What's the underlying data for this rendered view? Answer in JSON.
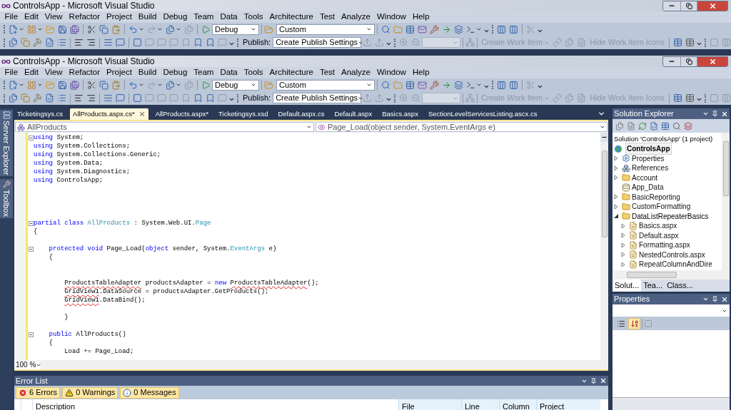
{
  "windows": [
    {
      "title": "ControlsApp - Microsoft Visual Studio",
      "menu": [
        "File",
        "Edit",
        "View",
        "Refactor",
        "Project",
        "Build",
        "Debug",
        "Team",
        "Data",
        "Tools",
        "Architecture",
        "Test",
        "Analyze",
        "Window",
        "Help"
      ],
      "toolbar": {
        "configuration": "Debug",
        "platform": "Custom",
        "publish_label": "Publish:",
        "publish_setting": "Create Publish Settings",
        "work_item": {
          "label": "Create Work Item",
          "disabled": true
        },
        "hide_icons": {
          "label": "Hide Work Item Icons",
          "disabled": true
        }
      }
    },
    {
      "title": "ControlsApp - Microsoft Visual Studio",
      "menu": [
        "File",
        "Edit",
        "View",
        "Refactor",
        "Project",
        "Build",
        "Debug",
        "Team",
        "Data",
        "Tools",
        "Architecture",
        "Test",
        "Analyze",
        "Window",
        "Help"
      ],
      "toolbar": {
        "configuration": "Debug",
        "platform": "Custom",
        "publish_label": "Publish:",
        "publish_setting": "Create Publish Settings",
        "work_item": {
          "label": "Create Work Item",
          "disabled": true
        },
        "hide_icons": {
          "label": "Hide Work Item Icons",
          "disabled": true
        }
      }
    }
  ],
  "left_dock": [
    "Server Explorer",
    "Toolbox"
  ],
  "editor": {
    "tabs": [
      {
        "label": "Ticketingsys.cs",
        "selected": false
      },
      {
        "label": "AllProducts.aspx.cs*",
        "selected": true
      },
      {
        "label": "AllProducts.aspx*",
        "selected": false
      },
      {
        "label": "Ticketingsys.xsd",
        "selected": false
      },
      {
        "label": "Default.aspx.cs",
        "selected": false
      },
      {
        "label": "Default.aspx",
        "selected": false
      },
      {
        "label": "Basics.aspx",
        "selected": false
      },
      {
        "label": "SectionLevelServicesListing.ascx.cs",
        "selected": false
      }
    ],
    "class_dropdown": "AllProducts",
    "member_dropdown": "Page_Load(object sender, System.EventArgs e)",
    "lines": [
      {
        "kind": "code",
        "fold": true,
        "tokens": [
          {
            "kind": "keyword",
            "text": "using"
          },
          {
            "kind": "plain",
            "text": " System;"
          }
        ]
      },
      {
        "kind": "code",
        "fold": false,
        "tokens": [
          {
            "kind": "keyword",
            "text": "using"
          },
          {
            "kind": "plain",
            "text": " System.Collections;"
          }
        ]
      },
      {
        "kind": "code",
        "fold": false,
        "tokens": [
          {
            "kind": "keyword",
            "text": "using"
          },
          {
            "kind": "plain",
            "text": " System.Collections.Generic;"
          }
        ]
      },
      {
        "kind": "code",
        "fold": false,
        "tokens": [
          {
            "kind": "keyword",
            "text": "using"
          },
          {
            "kind": "plain",
            "text": " System.Data;"
          }
        ]
      },
      {
        "kind": "code",
        "fold": false,
        "tokens": [
          {
            "kind": "keyword",
            "text": "using"
          },
          {
            "kind": "plain",
            "text": " System.Diagnostics;"
          }
        ]
      },
      {
        "kind": "code",
        "fold": false,
        "tokens": [
          {
            "kind": "keyword",
            "text": "using"
          },
          {
            "kind": "plain",
            "text": " ControlsApp;"
          }
        ]
      },
      {
        "kind": "blank",
        "fold": false
      },
      {
        "kind": "blank",
        "fold": false
      },
      {
        "kind": "blank",
        "fold": false
      },
      {
        "kind": "blank",
        "fold": false
      },
      {
        "kind": "code",
        "fold": true,
        "tokens": [
          {
            "kind": "keyword",
            "text": "partial class"
          },
          {
            "kind": "type",
            "text": " AllProducts"
          },
          {
            "kind": "plain",
            "text": " : System.Web.UI."
          },
          {
            "kind": "type",
            "text": "Page"
          }
        ]
      },
      {
        "kind": "code",
        "fold": false,
        "tokens": [
          {
            "kind": "plain",
            "text": "{"
          }
        ]
      },
      {
        "kind": "blank",
        "fold": false
      },
      {
        "kind": "code",
        "fold": true,
        "tokens": [
          {
            "kind": "keyword",
            "text": "    protected void"
          },
          {
            "kind": "plain",
            "text": " Page_Load("
          },
          {
            "kind": "keyword",
            "text": "object"
          },
          {
            "kind": "plain",
            "text": " sender, System."
          },
          {
            "kind": "type",
            "text": "EventArgs"
          },
          {
            "kind": "plain",
            "text": " e)"
          }
        ]
      },
      {
        "kind": "code",
        "fold": false,
        "tokens": [
          {
            "kind": "plain",
            "text": "    {"
          }
        ]
      },
      {
        "kind": "blank",
        "fold": false
      },
      {
        "kind": "blank",
        "fold": false
      },
      {
        "kind": "code",
        "fold": false,
        "tokens": [
          {
            "kind": "error",
            "text": "        ProductsTableAdapter"
          },
          {
            "kind": "plain",
            "text": " productsAdapter = "
          },
          {
            "kind": "keyword",
            "text": "new"
          },
          {
            "kind": "error",
            "text": " ProductsTableAdapter"
          },
          {
            "kind": "plain",
            "text": "();"
          }
        ]
      },
      {
        "kind": "code",
        "fold": false,
        "tokens": [
          {
            "kind": "error",
            "text": "        GridView1"
          },
          {
            "kind": "plain",
            "text": ".DataSource = productsAdapter.GetProducts();"
          }
        ]
      },
      {
        "kind": "code",
        "fold": false,
        "tokens": [
          {
            "kind": "error",
            "text": "        GridView1"
          },
          {
            "kind": "plain",
            "text": ".DataBind();"
          }
        ]
      },
      {
        "kind": "blank",
        "fold": false
      },
      {
        "kind": "code",
        "fold": false,
        "tokens": [
          {
            "kind": "plain",
            "text": "        }"
          }
        ]
      },
      {
        "kind": "blank",
        "fold": false
      },
      {
        "kind": "code",
        "fold": true,
        "tokens": [
          {
            "kind": "keyword",
            "text": "    public"
          },
          {
            "kind": "plain",
            "text": " AllProducts()"
          }
        ]
      },
      {
        "kind": "code",
        "fold": false,
        "tokens": [
          {
            "kind": "plain",
            "text": "    {"
          }
        ]
      },
      {
        "kind": "code",
        "fold": false,
        "tokens": [
          {
            "kind": "plain",
            "text": "        Load += Page_Load;"
          }
        ]
      }
    ],
    "zoom": "100 %"
  },
  "error_list": {
    "title": "Error List",
    "filters": [
      {
        "kind": "error",
        "label": "6 Errors",
        "selected": true
      },
      {
        "kind": "warning",
        "label": "0 Warnings",
        "selected": true
      },
      {
        "kind": "message",
        "label": "0 Messages",
        "selected": true
      }
    ],
    "columns": [
      "Description",
      "File",
      "Line",
      "Column",
      "Project"
    ]
  },
  "solution_explorer": {
    "title": "Solution Explorer",
    "solution": "Solution 'ControlsApp' (1 project)",
    "project": {
      "label": "ControlsApp",
      "selected": true
    },
    "items": [
      {
        "kind": "properties",
        "label": "Properties",
        "expandable": true,
        "expanded": false
      },
      {
        "kind": "references",
        "label": "References",
        "expandable": true,
        "expanded": false
      },
      {
        "kind": "folder",
        "label": "Account",
        "expandable": true,
        "expanded": false
      },
      {
        "kind": "data_folder",
        "label": "App_Data",
        "expandable": false
      },
      {
        "kind": "folder",
        "label": "BasicReporting",
        "expandable": true,
        "expanded": false
      },
      {
        "kind": "folder",
        "label": "CustomFormatting",
        "expandable": true,
        "expanded": false
      },
      {
        "kind": "folder",
        "label": "DataListRepeaterBasics",
        "expandable": true,
        "expanded": true,
        "children": [
          {
            "kind": "page",
            "label": "Basics.aspx",
            "expandable": true,
            "expanded": false
          },
          {
            "kind": "page",
            "label": "Default.aspx",
            "expandable": true,
            "expanded": false
          },
          {
            "kind": "page",
            "label": "Formatting.aspx",
            "expandable": true,
            "expanded": false
          },
          {
            "kind": "page",
            "label": "NestedControls.aspx",
            "expandable": true,
            "expanded": false
          },
          {
            "kind": "page",
            "label": "RepeatColumnAndDire",
            "expandable": true,
            "expanded": false
          }
        ]
      }
    ],
    "tabs": [
      {
        "label": "Solut...",
        "selected": true
      },
      {
        "label": "Tea...",
        "selected": false
      },
      {
        "label": "Class...",
        "selected": false
      }
    ]
  },
  "properties": {
    "title": "Properties",
    "sort_buttons": [
      {
        "kind": "categorized",
        "selected": false
      },
      {
        "kind": "alphabetical",
        "selected": true
      }
    ]
  }
}
